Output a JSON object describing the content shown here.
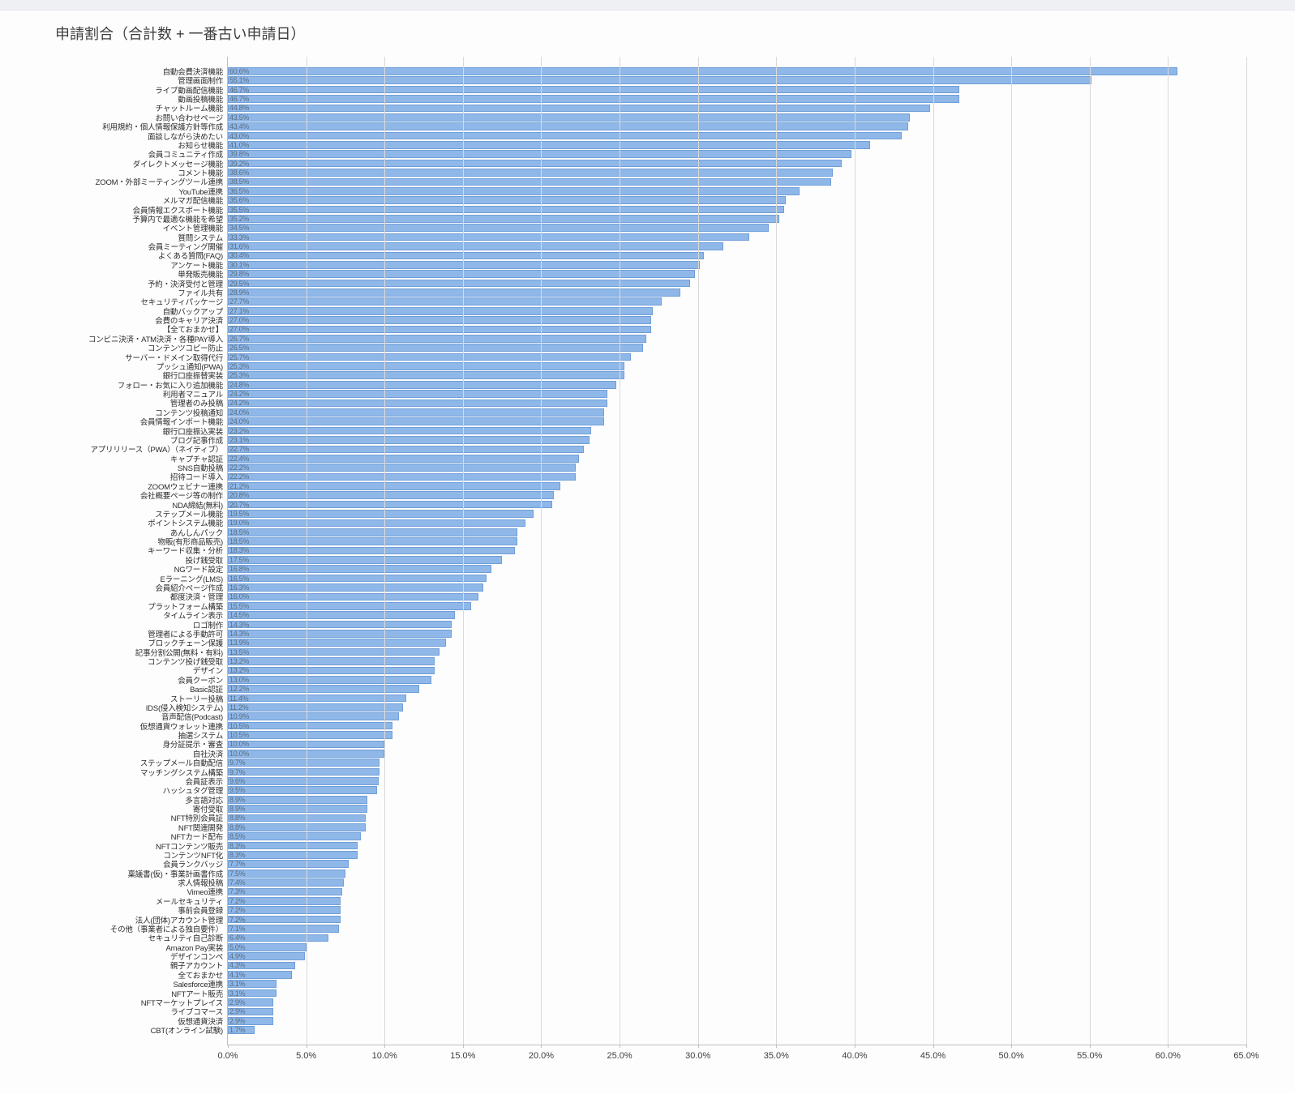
{
  "title": "申請割合（合計数 + 一番古い申請日）",
  "xaxis": {
    "min": 0,
    "max": 65.0,
    "step": 5.0,
    "suffix": "%"
  },
  "chart_data": {
    "type": "bar",
    "title": "申請割合（合計数 + 一番古い申請日）",
    "xlabel": "",
    "ylabel": "",
    "xlim": [
      0,
      65
    ],
    "categories": [
      "自動会費決済機能",
      "管理画面制作",
      "ライブ動画配信機能",
      "動画投稿機能",
      "チャットルーム機能",
      "お問い合わせページ",
      "利用規約・個人情報保護方針等作成",
      "面談しながら決めたい",
      "お知らせ機能",
      "会員コミュニティ作成",
      "ダイレクトメッセージ機能",
      "コメント機能",
      "ZOOM・外部ミーティングツール連携",
      "YouTube連携",
      "メルマガ配信機能",
      "会員情報エクスポート機能",
      "予算内で最適な機能を希望",
      "イベント管理機能",
      "質問システム",
      "会員ミーティング開催",
      "よくある質問(FAQ)",
      "アンケート機能",
      "単発販売機能",
      "予約・決済受付と管理",
      "ファイル共有",
      "セキュリティパッケージ",
      "自動バックアップ",
      "会費のキャリア決済",
      "【全ておまかせ】",
      "コンビニ決済・ATM決済・各種PAY導入",
      "コンテンツコピー防止",
      "サーバー・ドメイン取得代行",
      "プッシュ通知(PWA)",
      "銀行口座振替実装",
      "フォロー・お気に入り追加機能",
      "利用者マニュアル",
      "管理者のみ投稿",
      "コンテンツ投稿通知",
      "会員情報インポート機能",
      "銀行口座振込実装",
      "ブログ記事作成",
      "アプリリリース（PWA）（ネイティブ）",
      "キャプチャ認証",
      "SNS自動投稿",
      "招待コード導入",
      "ZOOMウェビナー連携",
      "会社概要ページ等の制作",
      "NDA締結(無料)",
      "ステップメール機能",
      "ポイントシステム機能",
      "あんしんパック",
      "物販(有形商品販売)",
      "キーワード収集・分析",
      "投げ銭受取",
      "NGワード設定",
      "Eラーニング(LMS)",
      "会員紹介ページ作成",
      "都度決済・管理",
      "プラットフォーム構築",
      "タイムライン表示",
      "ロゴ制作",
      "管理者による手動許可",
      "ブロックチェーン保護",
      "記事分割公開(無料・有料)",
      "コンテンツ投げ銭受取",
      "デザイン",
      "会員クーポン",
      "Basic認証",
      "ストーリー投稿",
      "IDS(侵入検知システム)",
      "音声配信(Podcast)",
      "仮想通貨ウォレット連携",
      "抽選システム",
      "身分証提示・審査",
      "自社決済",
      "ステップメール自動配信",
      "マッチングシステム構築",
      "会員証表示",
      "ハッシュタグ管理",
      "多言語対応",
      "寄付受取",
      "NFT特別会員証",
      "NFT関連開発",
      "NFTカード配布",
      "NFTコンテンツ販売",
      "コンテンツNFT化",
      "会員ランクバッジ",
      "稟議書(仮)・事業計画書作成",
      "求人情報投稿",
      "Vimeo連携",
      "メールセキュリティ",
      "事前会員登録",
      "法人(団体)アカウント管理",
      "その他（事業者による独自要件）",
      "セキュリティ自己診断",
      "Amazon Pay実装",
      "デザインコンペ",
      "親子アカウント",
      "全ておまかせ",
      "Salesforce連携",
      "NFTアート販売",
      "NFTマーケットプレイス",
      "ライブコマース",
      "仮想通貨決済",
      "CBT(オンライン試験)"
    ],
    "values": [
      60.6,
      55.1,
      46.7,
      46.7,
      44.8,
      43.5,
      43.4,
      43.0,
      41.0,
      39.8,
      39.2,
      38.6,
      38.5,
      36.5,
      35.6,
      35.5,
      35.2,
      34.5,
      33.3,
      31.6,
      30.4,
      30.1,
      29.8,
      29.5,
      28.9,
      27.7,
      27.1,
      27.0,
      27.0,
      26.7,
      26.5,
      25.7,
      25.3,
      25.3,
      24.8,
      24.2,
      24.2,
      24.0,
      24.0,
      23.2,
      23.1,
      22.7,
      22.4,
      22.2,
      22.2,
      21.2,
      20.8,
      20.7,
      19.5,
      19.0,
      18.5,
      18.5,
      18.3,
      17.5,
      16.8,
      16.5,
      16.3,
      16.0,
      15.5,
      14.5,
      14.3,
      14.3,
      13.9,
      13.5,
      13.2,
      13.2,
      13.0,
      12.2,
      11.4,
      11.2,
      10.9,
      10.5,
      10.5,
      10.0,
      10.0,
      9.7,
      9.7,
      9.6,
      9.5,
      8.9,
      8.9,
      8.8,
      8.8,
      8.5,
      8.3,
      8.3,
      7.7,
      7.5,
      7.4,
      7.3,
      7.2,
      7.2,
      7.2,
      7.1,
      6.4,
      5.0,
      4.9,
      4.3,
      4.1,
      3.1,
      3.1,
      2.9,
      2.9,
      2.9,
      1.7
    ]
  }
}
